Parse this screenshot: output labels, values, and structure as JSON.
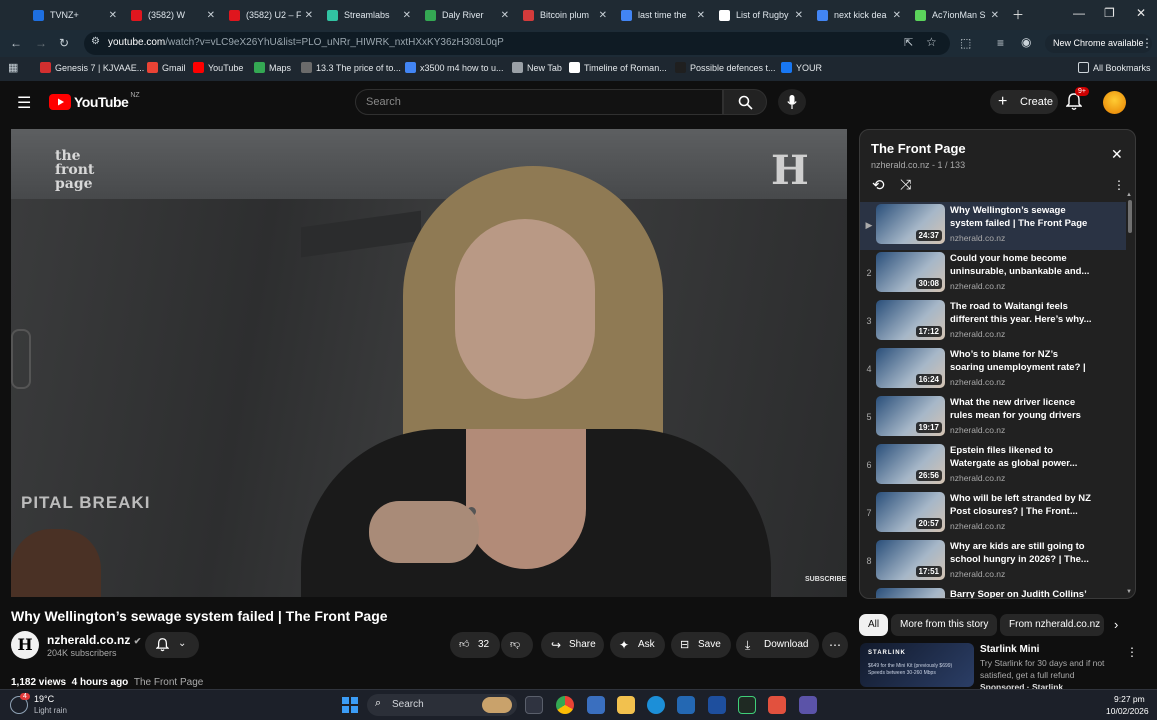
{
  "browser": {
    "tabs": [
      {
        "title": "TVNZ+",
        "color": "#1e6fe0"
      },
      {
        "title": "(3582) W",
        "color": "#e0161e"
      },
      {
        "title": "(3582) U2 – F",
        "color": "#e0161e"
      },
      {
        "title": "Streamlabs",
        "color": "#31c3a2"
      },
      {
        "title": "Daly River",
        "color": "#34a853"
      },
      {
        "title": "Bitcoin plum",
        "color": "#d33b3b"
      },
      {
        "title": "last time the",
        "color": "#4285f4"
      },
      {
        "title": "List of Rugby",
        "color": "#ffffff"
      },
      {
        "title": "next kick dea",
        "color": "#4285f4"
      },
      {
        "title": "Ac7ionMan S",
        "color": "#5bd35b"
      }
    ],
    "url_host": "youtube.com",
    "url_path": "/watch?v=vLC9eX26YhU&list=PLO_uNRr_HIWRK_nxtHXxKY36zH308L0qP",
    "update_label": "New Chrome available",
    "bookmarks": [
      {
        "label": "Genesis 7 | KJVAAE...",
        "color": "#d32f2f"
      },
      {
        "label": "Gmail",
        "color": "#ea4335"
      },
      {
        "label": "YouTube",
        "color": "#ff0000"
      },
      {
        "label": "Maps",
        "color": "#34a853"
      },
      {
        "label": "13.3 The price of to...",
        "color": "#6b6b6b"
      },
      {
        "label": "x3500 m4 how to u...",
        "color": "#4285f4"
      },
      {
        "label": "New Tab",
        "color": "#9aa0a6"
      },
      {
        "label": "Timeline of Roman...",
        "color": "#ffffff"
      },
      {
        "label": "Possible defences t...",
        "color": "#1f1f1f"
      },
      {
        "label": "YOUR",
        "color": "#1877f2"
      }
    ],
    "all_bookmarks_label": "All Bookmarks"
  },
  "youtube": {
    "logo_text": "YouTube",
    "logo_region": "NZ",
    "search_placeholder": "Search",
    "create_label": "Create",
    "notif_count": "9+",
    "video": {
      "title": "Why Wellington’s sewage system failed | The Front Page",
      "channel": "nzherald.co.nz",
      "subscribers": "204K subscribers",
      "likes": "32",
      "share_label": "Share",
      "ask_label": "Ask",
      "save_label": "Save",
      "download_label": "Download",
      "views": "1,182 views",
      "age": "4 hours ago",
      "tag": "The Front Page",
      "overlay": {
        "brand_left_1": "the",
        "brand_left_2": "front",
        "brand_left_3": "page",
        "brand_right": "H",
        "bg_text": "PITAL BREAKI",
        "watermark": "SUBSCRIBE"
      }
    },
    "playlist": {
      "title": "The Front Page",
      "channel": "nzherald.co.nz",
      "position": "1 / 133",
      "items": [
        {
          "index": "▶",
          "title": "Why Wellington’s sewage system failed | The Front Page",
          "channel": "nzherald.co.nz",
          "duration": "24:37"
        },
        {
          "index": "2",
          "title": "Could your home become uninsurable, unbankable and...",
          "channel": "nzherald.co.nz",
          "duration": "30:08"
        },
        {
          "index": "3",
          "title": "The road to Waitangi feels different this year. Here’s why...",
          "channel": "nzherald.co.nz",
          "duration": "17:12"
        },
        {
          "index": "4",
          "title": "Who’s to blame for NZ’s soaring unemployment rate? | The...",
          "channel": "nzherald.co.nz",
          "duration": "16:24"
        },
        {
          "index": "5",
          "title": "What the new driver licence rules mean for young drivers |...",
          "channel": "nzherald.co.nz",
          "duration": "19:17"
        },
        {
          "index": "6",
          "title": "Epstein files likened to Watergate as global power...",
          "channel": "nzherald.co.nz",
          "duration": "26:56"
        },
        {
          "index": "7",
          "title": "Who will be left stranded by NZ Post closures? | The Front...",
          "channel": "nzherald.co.nz",
          "duration": "20:57"
        },
        {
          "index": "8",
          "title": "Why are kids are still going to school hungry in 2026? | The...",
          "channel": "nzherald.co.nz",
          "duration": "17:51"
        },
        {
          "index": "",
          "title": "Barry Soper on Judith Collins’",
          "channel": "",
          "duration": ""
        }
      ]
    },
    "chips": [
      "All",
      "More from this story",
      "From nzherald.co.nz"
    ],
    "ad": {
      "brand": "STARLINK",
      "fine_print": "$649 for the Mini Kit (previously $699) Speeds between 30-260 Mbps",
      "title": "Starlink Mini",
      "description": "Try Starlink for 30 days and if not satisfied, get a full refund",
      "sponsored": "Sponsored · Starlink"
    }
  },
  "taskbar": {
    "weather_temp": "19°C",
    "weather_desc": "Light rain",
    "weather_badge": "4",
    "search_placeholder": "Search",
    "time": "9:27 pm",
    "date": "10/02/2026"
  }
}
